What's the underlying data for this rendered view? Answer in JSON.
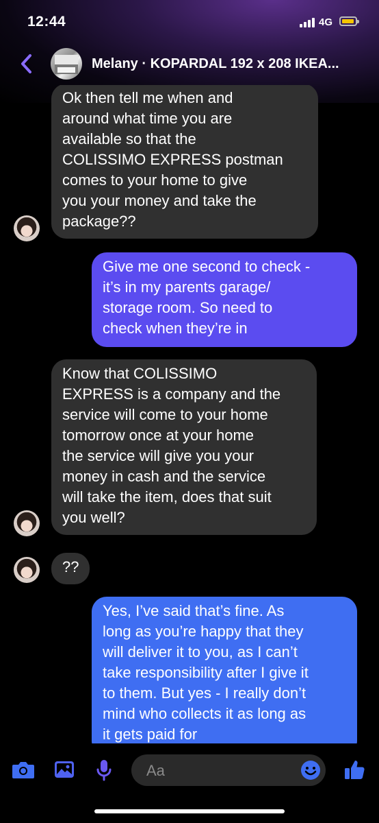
{
  "status_bar": {
    "time": "12:44",
    "network": "4G"
  },
  "header": {
    "title": "Melany · KOPARDAL 192 x 208 IKEA..."
  },
  "colors": {
    "accent": "#8a6cff",
    "incoming_bubble": "#303030",
    "out_purple": "#5b4cf0",
    "out_blue": "#3f6ef2",
    "background": "#000000"
  },
  "messages": [
    {
      "direction": "incoming",
      "lines": [
        "Ok then tell me when and",
        "around what time you are",
        "available so that the",
        "COLISSIMO EXPRESS postman",
        "comes to your home to give",
        "you your money and take the",
        "package??"
      ]
    },
    {
      "direction": "outgoing",
      "lines": [
        "Give me one second to check -",
        "it’s in my parents garage/",
        "storage room. So need to",
        "check when they’re in"
      ]
    },
    {
      "direction": "incoming",
      "lines": [
        "Know that COLISSIMO",
        "EXPRESS is a company and the",
        "service will come to your home",
        "tomorrow once at your home",
        "the service will give you your",
        "money in cash and the service",
        "will take the item, does that suit",
        "you well?"
      ]
    },
    {
      "direction": "incoming",
      "lines": [
        "??"
      ]
    },
    {
      "direction": "outgoing",
      "lines": [
        "Yes, I’ve said that’s fine. As",
        "long as you’re happy that they",
        "will deliver it to you, as I can’t",
        "take responsibility after I give it",
        "to them. But yes - I really don’t",
        "mind who collects it as long as",
        "it gets paid for"
      ]
    }
  ],
  "composer": {
    "placeholder": "Aa",
    "icons": [
      "camera-icon",
      "gallery-icon",
      "microphone-icon",
      "emoji-icon",
      "thumbs-up-icon"
    ]
  }
}
